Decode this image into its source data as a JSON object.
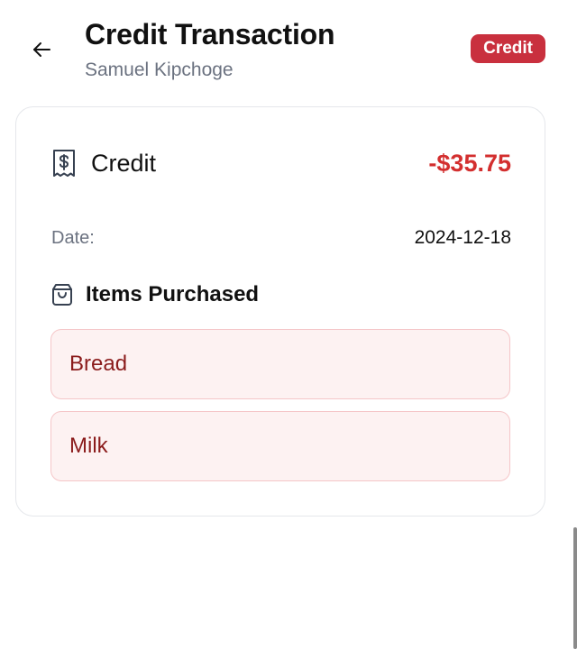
{
  "header": {
    "title": "Credit Transaction",
    "subtitle": "Samuel Kipchoge",
    "badge": "Credit",
    "back_icon": "arrow-left-icon"
  },
  "summary": {
    "icon": "receipt-icon",
    "type": "Credit",
    "amount": "-$35.75"
  },
  "details": {
    "date_label": "Date:",
    "date_value": "2024-12-18"
  },
  "items_section": {
    "icon": "shopping-bag-icon",
    "title": "Items Purchased",
    "items": [
      "Bread",
      "Milk"
    ]
  },
  "colors": {
    "accent": "#c9303e",
    "amount": "#d32f2f",
    "item_bg": "#fdf2f2",
    "item_border": "#f5c6c8",
    "item_text": "#8b1c1c"
  }
}
